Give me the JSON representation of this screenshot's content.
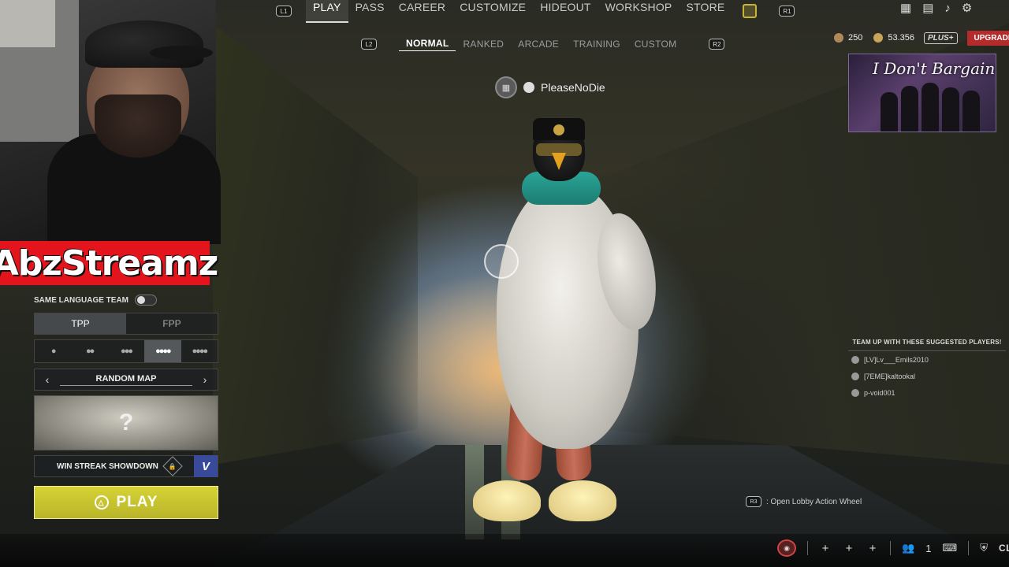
{
  "streamer": {
    "name": "AbzStreamz"
  },
  "nav": {
    "left_badge": "L1",
    "right_badge": "R1",
    "tabs": [
      {
        "label": "PLAY",
        "active": true
      },
      {
        "label": "PASS",
        "active": false
      },
      {
        "label": "CAREER",
        "active": false
      },
      {
        "label": "CUSTOMIZE",
        "active": false
      },
      {
        "label": "HIDEOUT",
        "active": false
      },
      {
        "label": "WORKSHOP",
        "active": false
      },
      {
        "label": "STORE",
        "active": false
      }
    ],
    "store_icon": "cube-icon"
  },
  "modes": {
    "left_badge": "L2",
    "right_badge": "R2",
    "items": [
      {
        "label": "NORMAL",
        "active": true
      },
      {
        "label": "RANKED",
        "active": false
      },
      {
        "label": "ARCADE",
        "active": false
      },
      {
        "label": "TRAINING",
        "active": false
      },
      {
        "label": "CUSTOM",
        "active": false
      }
    ]
  },
  "player": {
    "name": "PleaseNoDie"
  },
  "currency": {
    "bp": "250",
    "gcoin": "53.356",
    "plus_label": "PLUS+",
    "upgrade_label": "UPGRADE"
  },
  "promo": {
    "text": "I Don't Bargain"
  },
  "panel": {
    "same_language_label": "SAME LANGUAGE TEAM",
    "perspectives": [
      {
        "label": "TPP",
        "active": true
      },
      {
        "label": "FPP",
        "active": false
      }
    ],
    "squad_sizes": [
      {
        "label": "●",
        "active": false
      },
      {
        "label": "●●",
        "active": false
      },
      {
        "label": "●●●",
        "active": false
      },
      {
        "label": "●●●●",
        "active": true
      },
      {
        "label": "●●●●",
        "active": false
      }
    ],
    "map_label": "RANDOM MAP",
    "map_prev": "‹",
    "map_next": "›",
    "map_placeholder": "?",
    "streak_label": "WIN STREAK SHOWDOWN",
    "streak_badge": "V",
    "play_label": "PLAY",
    "play_icon": "△"
  },
  "suggest": {
    "header": "TEAM UP WITH THESE SUGGESTED PLAYERS!",
    "players": [
      "[LV]Lv___Emils2010",
      "[7EME]kaltookal",
      "p-void001"
    ]
  },
  "action_wheel": {
    "badge": "R3",
    "label": ": Open Lobby Action Wheel"
  },
  "bottom": {
    "party_count": "1",
    "clan_label": "CLAN"
  },
  "colors": {
    "play_button": "#c9c530",
    "upgrade": "#b52a2a",
    "brand": "#e3141b"
  }
}
